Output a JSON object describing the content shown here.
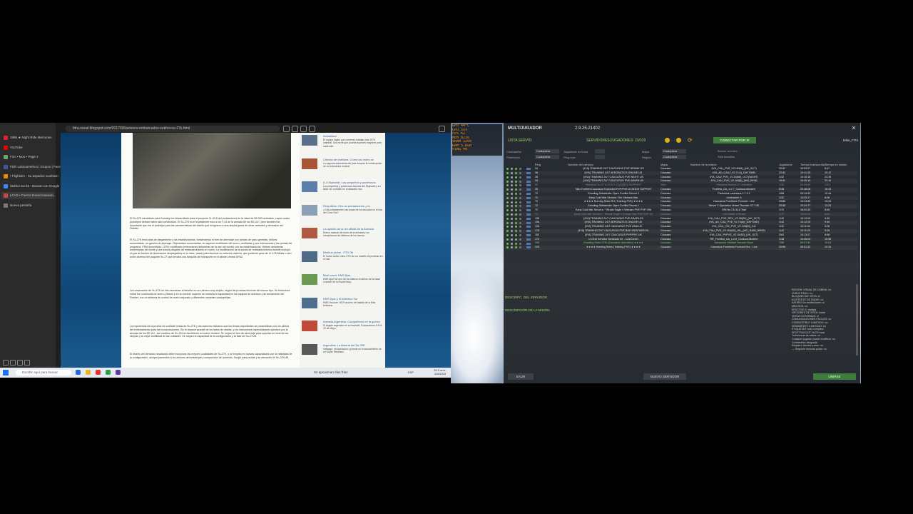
{
  "browser": {
    "tabs": [
      {
        "label": "1996 ★ Night Ride Memories",
        "color": "#d23"
      },
      {
        "label": "YouTube",
        "color": "#e00"
      },
      {
        "label": "F1H • Mon • Page 4",
        "color": "#6a6"
      },
      {
        "label": "FDR Latinoamérica | Grupos | Faceb",
        "color": "#3b5998"
      },
      {
        "label": "• Flightsim · Su aspados southwin",
        "color": "#e80"
      },
      {
        "label": "Sukhoi Su-33 - Buscar con Google",
        "color": "#4285f4"
      },
      {
        "label": "LCAS • Fuerza Naval Assisem...",
        "color": "#c44"
      },
      {
        "label": "Nueva pestaña",
        "color": "#777"
      }
    ],
    "active_tab_index": 6,
    "address": "fdra-naval.blogspot.com/2017/08/aviones-embarcados-sukhoi-su-27k.html",
    "article": {
      "paragraphs": [
        "El Su-27K navalizado para Kuzalny fue desarrollado para el proyecto 11-43.5 del portaaviones de la clase de 55.000 toneladas, cuyos cuatro prototipos debían haber sido construidos. El Su-27K es el equivalente ruso a los F-14 de la armada de los EE.UU., pero también fue importante que era el prototipo para las características del diseño que emigraron a una amplia gama de otras variantes y derivados del Flanker.",
        "El Su-27K tenía alas de plegamiento y las estabilizadoras, fortaleciendo el tren de aterrizaje con ruedas de paso gemelas, hélices aumentadas, un gancho de apontaje. Reposaban aumentadas, un aspecto modificado del morro, ventiladas y sus extensiones y las puntas del programa. FRM aumentado. LERX modificado (extensiones delanteras de la raíz del borde) con las estabilizadoras. Hélices delanteras aumentadas del borde y una sonda plegable de reabastecimiento en vuelo. La modificación de la sonda de reabastecimiento también incluyó un par de faroles de iluminación desplegables en la nariz, usado para iluminar los aviones cisterna, que pudieran para ser el Il-78 Midas u otro avión cisterna del paquete Su-27 que llevaba una barquilla del transporte en el afuste central UPAZ.",
        "La construcción de Su-27K se hizo aumentar el tamaño en un número muy amplio, según las pruebas técnicas del mismo tipo. Su estructura inicial fue construida de acero y titanio y en su versión superior se muestra la capacidad en los equipos de aviónica y de armamento del Flanker, con un sistema de control de vuelo mejorado y diferentes variantes compartidas.",
        "La experiencia de la prueba de combate inicial de Su-27K y los avances indicaron que los temas importantes se presentaban con los pilotos del entrenamiento para las incorporaciones. Sin el alcance grande de los lados de misiles, y los instructores especializados operaron por la armada de los EE.UU., los modelos de Su-33 fue escribieron un nuevo modelo. Se mejoró el tren de aterrizaje para soportar un nivel de las rampas y la mejor visibilidad de las unidades. Se mejoró la capacidad de la configuración y la fase de Su-27UB.",
        "El diseño del derivado navalizado debe incorporar las mejores cualidades de Su-27K, y se empleó en nuevas capacidades con la visibilidad de la configuración, aunque parecidos a los aviones del embarque y compuestos de aumento. Surgió para probar y se denominó el Su-27KUB."
      ]
    },
    "sidebar_posts": [
      {
        "title": "Actualidad",
        "desc": "El equipo inglés que comenzó batallas tras 1974 catedral. Una serie que prueba avances mayores para cada sitio."
      },
      {
        "title": "Ciencia del mañana: Cómo las redes se protegieron de los submarinos",
        "desc": "La espuma submarina del país durante la construcción de un submarino nuclear."
      },
      {
        "title": "A-4 Skyhawk: Los pequeños y poderosos aviones",
        "desc": "Los pequeños y poderosos aviones del Skyhawk y su labor de combate en el Atlántico Sur."
      },
      {
        "title": "Requisitos: Gris un portaaviones ¿es alcanzable?",
        "desc": "¿Gris portaaviones, las cosas de los escudos en el mar del Cono Sur?"
      },
      {
        "title": "La opinión de un ex oficial de la Armada",
        "desc": "Nuevo manual de fondo de la armada y los mecanismos de defensa de los barcos."
      },
      {
        "title": "Nimbus probe - FTD 96",
        "desc": "El nuevo avión chino ZTD sin un modelo de pruebas en el mar."
      },
      {
        "title": "Misil naval: HMS Ajax",
        "desc": "HMS Ajax fue uno de los últimos cruceros de la clase Leander de la Royal Navy."
      },
      {
        "title": "HMS Ajax y el Atlántico Sur",
        "desc": "HMS Hood en 1919 crucero de batalla de la flota británica."
      },
      {
        "title": "Armada Argentina: Compañeros en la guerra",
        "desc": "El legado argentino en su historial. Portaaviones A.R.A. 25 de Mayo."
      },
      {
        "title": "Argentina: La historia del Su-33K",
        "desc": "Hallazgo, recuperación y puesta en funcionamiento de un Super Etendard."
      }
    ],
    "taskbar": {
      "search_placeholder": "Escribir aquí para buscar",
      "notification": "Se aproximan días frías",
      "time": "9:12 a.m.",
      "date": "6/4/2023",
      "lang": "ESP"
    }
  },
  "game": {
    "osd": [
      "GPU 44°C",
      "CPU 51%",
      "FPS 62",
      "MEM 8216",
      "VRAM 3200",
      "RAM 5.6GB",
      "PING 48"
    ],
    "title": "MULTIJUGADOR",
    "version": "2.9.25.21402",
    "server_list_label": "LISTA SERVID.",
    "servers_count": "SERVIDORES/JUGADORES: 23/329",
    "connect_ip_label": "CONECTAR POR IP",
    "user": "Mike_FOX",
    "filters": [
      {
        "label": "Contraseña",
        "value": "Cualquiera"
      },
      {
        "label": "Protección",
        "value": "Cualquiera"
      },
      {
        "label": "Jugadores en línea",
        "value": ""
      },
      {
        "label": "Ping máx.",
        "value": ""
      },
      {
        "label": "Mapa",
        "value": "Cualquiera"
      },
      {
        "label": "Región",
        "value": "Cualquiera"
      }
    ],
    "search_placeholder": "Buscar servidor...",
    "only_mine_label": "Sólo favoritos",
    "columns": [
      "Ping",
      "Nombre del servidor",
      "Mapa",
      "Nombre de la misión",
      "Jugadores",
      "Tiempo transcurrido",
      "Tiempo en misión"
    ],
    "rows": [
      {
        "ping": "34",
        "name": "[4YA] TRAINING 24/7 CAUCASUS PVE SEMAK US",
        "map": "Cáucaso",
        "mission": "4YA_CAU_PVE_V2.184(8)_(UK_SCT)",
        "players": "22/42",
        "elapsed": "10:53:07",
        "mtime": "8:47",
        "style": ""
      },
      {
        "ping": "36",
        "name": "[4YA] TRAINING 24/7 AEROBATICS ONLINE US",
        "map": "Cáucaso",
        "mission": "4YA_AD_CAUC.V2.74.6(_DAYTIME)",
        "players": "22/42",
        "elapsed": "10:41:26",
        "mtime": "19:12",
        "style": ""
      },
      {
        "ping": "36",
        "name": "[4YA] TRAINING 24/7 CAUCASUS PVE NIGHT US",
        "map": "Cáucaso",
        "mission": "4YA_CAU_PVE_V2.15(68)_OCT(NIGHT)",
        "players": "1/42",
        "elapsed": "10:10:18",
        "mtime": "21:25",
        "style": ""
      },
      {
        "ping": "34",
        "name": "[4YA] TRAINING 24/7 CAUCASUS PVE ARAPA US",
        "map": "Cáucaso",
        "mission": "4YA_CAU_PVE_V2.184(8)_(MN_DEW)",
        "players": "15/42",
        "elapsed": "10:49:10",
        "mtime": "22:10",
        "style": ""
      },
      {
        "ping": "53",
        "name": "Historical Su-27 & 33 & S-3 MODES SUPPORT",
        "map": "Siria",
        "mission": "Historical Sukhoi-27 Unlimited",
        "players": "1/32",
        "elapsed": "00:20:09",
        "mtime": "1:04",
        "style": "dim"
      },
      {
        "ping": "36",
        "name": "Max Foxfield Caucasus Expanded PVP/PVE AI MODS SUPPOR",
        "map": "Cáucaso",
        "mission": "Foxfield_CA_1.2.7_Cookout-Modern",
        "players": "8/48",
        "elapsed": "20:48:08",
        "mtime": "16:44",
        "style": ""
      },
      {
        "ping": "72",
        "name": "Growling Sidewinder Open Conflict Server 2",
        "map": "Cáucaso",
        "mission": "Prelamine caucasus 1.7.3.1",
        "players": "1/68",
        "elapsed": "03:14:42",
        "mtime": "12:44",
        "style": ""
      },
      {
        "ping": "72",
        "name": "Early Cold War Servers: The Vietnam War",
        "map": "Cáucaso",
        "mission": "Linebacker II",
        "players": "1/32",
        "elapsed": "10:25:17",
        "mtime": "8:28",
        "style": ""
      },
      {
        "ping": "72",
        "name": "★★★★ Burning Skies RH (Training PVE) ★★★★",
        "map": "Cáucaso",
        "mission": "Caucasus Frontlines Foxhold - Live",
        "players": "20/66",
        "elapsed": "10:24:50",
        "mtime": "13:24",
        "style": ""
      },
      {
        "ping": "72",
        "name": "Growling Sidewinder Open Conflict Server 1",
        "map": "Cáucaso",
        "mission": "Server 1 Operation Urban Thunder V7.7.80",
        "players": "20/48",
        "elapsed": "10:24:17",
        "mtime": "13:24",
        "style": ""
      },
      {
        "ping": "72",
        "name": "Early Cold War Servers: * Strade Eagle v Vietnam PVE PVP V56",
        "map": "Cáucaso",
        "mission": "V56 No CN M-8 Trail",
        "players": "1/72",
        "elapsed": "18:00:00",
        "mtime": "8:06",
        "style": ""
      },
      {
        "ping": "71",
        "name": "Early Cold War Servers: * Strade Eagle v Europe War PVE PVP V4",
        "map": "Cáucaso",
        "mission": "VSA Battle of Brasil",
        "players": "1/72",
        "elapsed": "18:03:04",
        "mtime": "8:06",
        "style": "dim"
      },
      {
        "ping": "136",
        "name": "[4YA] TRAINING 24/7 CAUCASUS PVE ARAPA EK",
        "map": "Cáucaso",
        "mission": "4YA_CAU_PVE_REV_V2.28(92)_(UK_SCT)",
        "players": "1/42",
        "elapsed": "10:13:00",
        "mtime": "9:36",
        "style": ""
      },
      {
        "ping": "136",
        "name": "[4YA] TRAINING 24/7 AEROBATICS ONLINE UK",
        "map": "Cáucaso",
        "mission": "4YA_AD_CAU_PVE_V2.74(6)(_DAYTIME)",
        "players": "1/42",
        "elapsed": "10:12:29",
        "mtime": "9:36",
        "style": ""
      },
      {
        "ping": "128",
        "name": "[4YA] TRAINING 24/7 CAUCASUS PVE ASIA UK",
        "map": "Cáucaso",
        "mission": "4YA_CAU_CW_PVE_V2.148(92)_IUL",
        "players": "1/42",
        "elapsed": "10:11:41",
        "mtime": "5:28",
        "style": ""
      },
      {
        "ping": "175",
        "name": "[4YA] TRAINING 24/7 CAUCASUS PVE BAD WEATHER EK",
        "map": "Cáucaso",
        "mission": "4YA_CAU_PVE_V2.154(92)_IUL_(WC_RAIN_WIND)",
        "players": "1/42",
        "elapsed": "10:11:23",
        "mtime": "5:28",
        "style": ""
      },
      {
        "ping": "152",
        "name": "[4YA] TRAINING 24/7 CAUCASUS PVP/PVE UK",
        "map": "Cáucaso",
        "mission": "4YA_CAU_PVPVE_V2.18(92)_(UK_SCT)",
        "players": "2/62",
        "elapsed": "10:13:07",
        "mtime": "8:06",
        "style": ""
      },
      {
        "ping": "173",
        "name": "CCGW Servidor Dedicado #2 - CAUCASO",
        "map": "Cáucaso",
        "mission": "RR_Foxfield_CA_1.2.5_Cookout-Modern",
        "players": "1/48",
        "elapsed": "10:06:00",
        "mtime": "10:55",
        "style": ""
      },
      {
        "ping": "296",
        "name": "Growling Skies 27M (Caucasus Operation) ★★★★",
        "map": "Cáucaso",
        "mission": "Advanced Warfare Nevada Slave",
        "players": "7/88",
        "elapsed": "09:57:54",
        "mtime": "10:01",
        "style": "green"
      },
      {
        "ping": "220",
        "name": "★★★★ Burning Skies (Training PVE) ★★★★",
        "map": "Cáucaso",
        "mission": "Caucasus Frontlines Foxhold Rev - Live",
        "players": "20/96",
        "elapsed": "08:51:32",
        "mtime": "10:33",
        "style": ""
      }
    ],
    "desc_title": "DESCRIPC. DEL SERVIDOR",
    "mission_title": "DESCRIPCIÓN DE LA MISIÓN",
    "server_options": [
      "REGIÓN: VISUAL DE CABINA: no",
      "VUELO FÁCIL: no",
      "BLOQUEO DE VISTA: sí",
      "ASISTENTE DE RADIO: no",
      "SATIRIO sin restricciones: sí",
      "MINI HUD: no",
      "EFECTOS G: realista",
      "OPCIONES DE VISTA: todas",
      "VISTAS EXTERNAS: sí",
      "COMUNICACIONES FÁCILES: no",
      "COMBUSTIBLE ILIMITADO: no",
      "ARMAMENTO ILIMITADO: no",
      "ETIQUETAS: todo completo",
      "SPOTTING DOT: NLTD local",
      "Turbulencia de estela: no",
      "Cualquier jugador puede modificar: no",
      "Contraseña: integrada",
      "Requiere clientes puros: no",
      "— Requiere texturas puras: no"
    ],
    "buttons": {
      "exit": "SALIR",
      "new_server": "NUEVO SERVIDOR",
      "join": "UNIRSE"
    }
  }
}
